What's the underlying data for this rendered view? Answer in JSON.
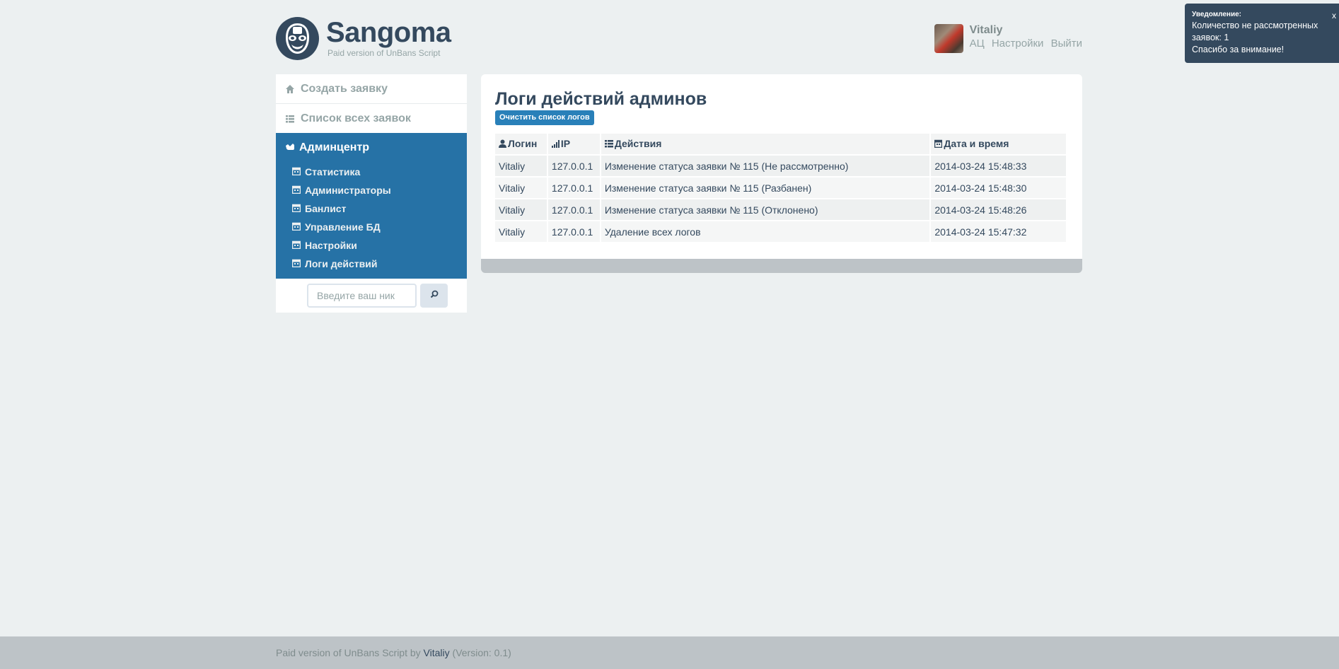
{
  "header": {
    "logo_title": "Sangoma",
    "logo_subtitle": "Paid version of UnBans Script",
    "user_name": "Vitaliy",
    "links": [
      "АЦ",
      "Настройки",
      "Выйти"
    ]
  },
  "notification": {
    "title": "Уведомление:",
    "line1": "Количество не рассмотренных заявок: 1",
    "line2": "Спасибо за внимание!",
    "close": "x"
  },
  "sidebar": {
    "create_request": "Создать заявку",
    "all_requests": "Список всех заявок",
    "admin_center": "Админцентр",
    "items": [
      {
        "label": "Статистика"
      },
      {
        "label": "Администраторы"
      },
      {
        "label": "Банлист"
      },
      {
        "label": "Управление БД"
      },
      {
        "label": "Настройки"
      },
      {
        "label": "Логи действий"
      }
    ],
    "search_placeholder": "Введите ваш ник"
  },
  "main": {
    "title": "Логи действий админов",
    "clear_button": "Очистить список логов",
    "columns": [
      "Логин",
      "IP",
      "Действия",
      "Дата и время"
    ],
    "rows": [
      {
        "login": "Vitaliy",
        "ip": "127.0.0.1",
        "action": "Изменение статуса заявки № 115 (Не рассмотренно)",
        "datetime": "2014-03-24 15:48:33"
      },
      {
        "login": "Vitaliy",
        "ip": "127.0.0.1",
        "action": "Изменение статуса заявки № 115 (Разбанен)",
        "datetime": "2014-03-24 15:48:30"
      },
      {
        "login": "Vitaliy",
        "ip": "127.0.0.1",
        "action": "Изменение статуса заявки № 115 (Отклонено)",
        "datetime": "2014-03-24 15:48:26"
      },
      {
        "login": "Vitaliy",
        "ip": "127.0.0.1",
        "action": "Удаление всех логов",
        "datetime": "2014-03-24 15:47:32"
      }
    ]
  },
  "footer": {
    "prefix": "Paid version of UnBans Script by",
    "author": "Vitaliy",
    "version": "(Version: 0.1)"
  },
  "colors": {
    "background": "#ecf0f1",
    "accent": "#2672a6",
    "button": "#2980b9",
    "text": "#34495e",
    "muted": "#95a5a6"
  },
  "icons": {
    "logo": "wrestler-mask-icon",
    "create": "home-icon",
    "list": "list-icon",
    "admin": "hand-icon",
    "subitem": "calendar-icon",
    "search": "search-icon",
    "login_col": "user-icon",
    "ip_col": "signal-icon",
    "actions_col": "list-icon",
    "date_col": "calendar-icon"
  }
}
